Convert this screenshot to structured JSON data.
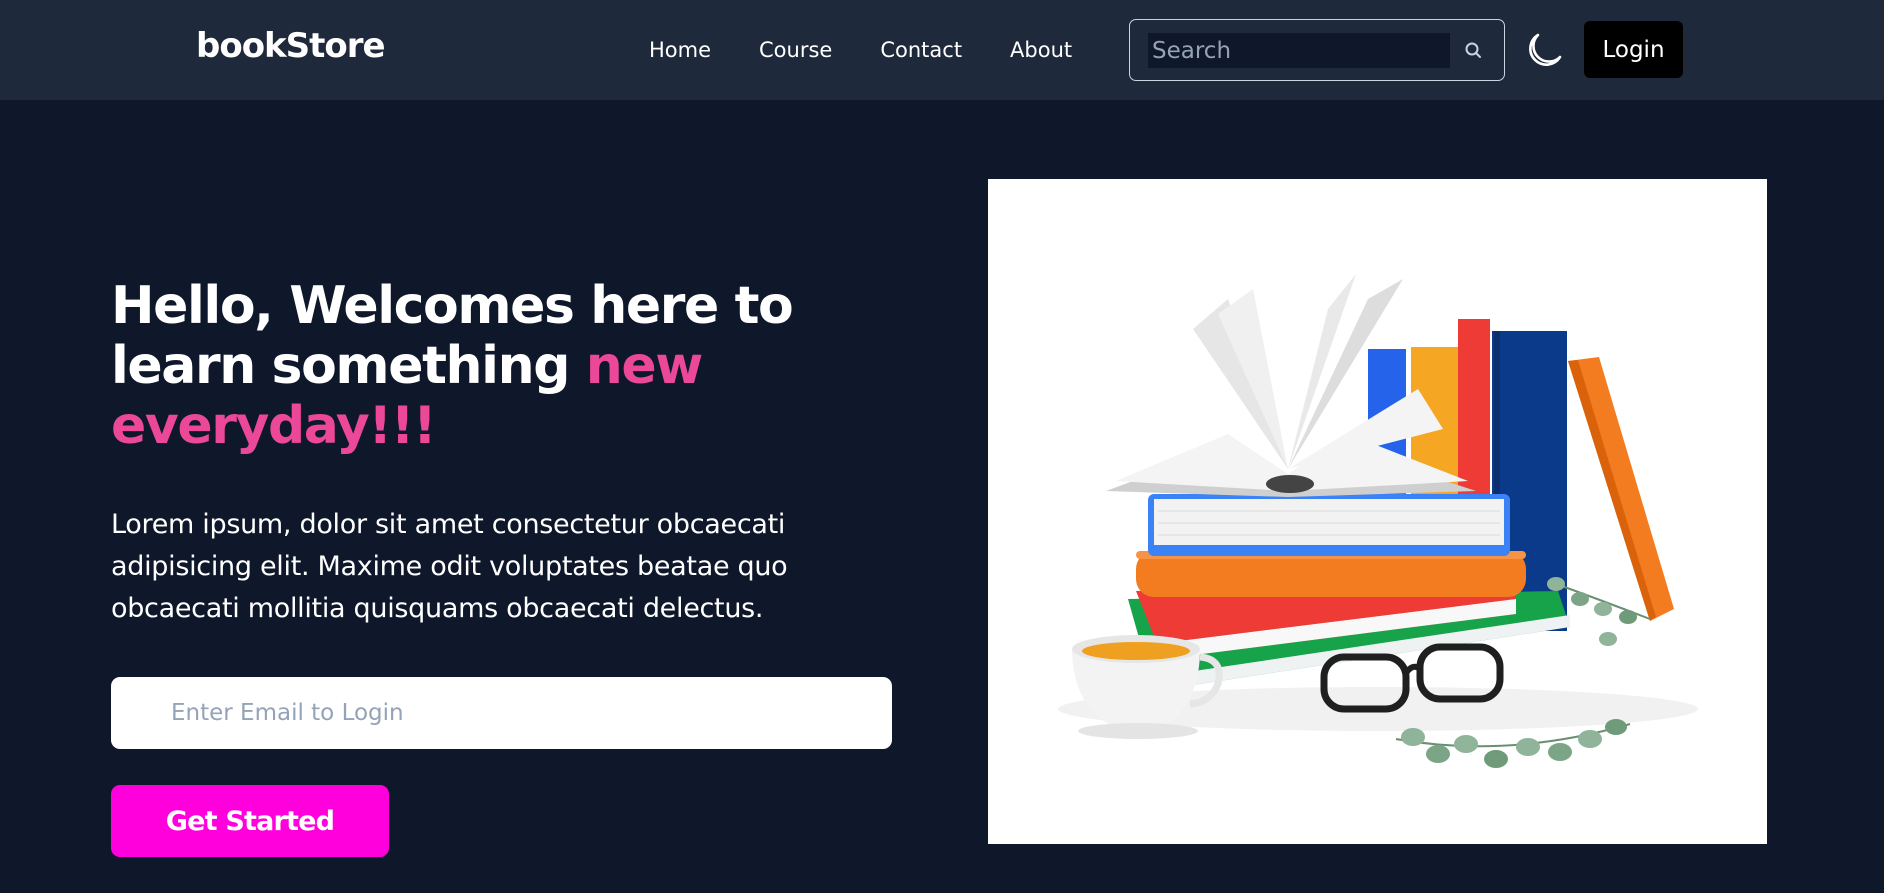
{
  "brand": {
    "name": "bookStore"
  },
  "nav": {
    "items": [
      {
        "label": "Home"
      },
      {
        "label": "Course"
      },
      {
        "label": "Contact"
      },
      {
        "label": "About"
      }
    ]
  },
  "search": {
    "placeholder": "Search",
    "value": "",
    "icon": "search-icon"
  },
  "theme_toggle": {
    "icon": "moon-icon"
  },
  "header": {
    "login_label": "Login"
  },
  "hero": {
    "title_part1": "Hello, Welcomes here to learn something ",
    "title_accent": "new everyday!!!",
    "description": "Lorem ipsum, dolor sit amet consectetur obcaecati adipisicing elit. Maxime odit voluptates beatae quo obcaecati mollitia quisquams obcaecati delectus.",
    "email_placeholder": "Enter Email to Login",
    "email_value": "",
    "cta_label": "Get Started"
  },
  "colors": {
    "nav_bg": "#1e293b",
    "page_bg": "#0f172a",
    "accent_text": "#ec4899",
    "cta_bg": "#ff00dd",
    "login_bg": "#000000"
  }
}
